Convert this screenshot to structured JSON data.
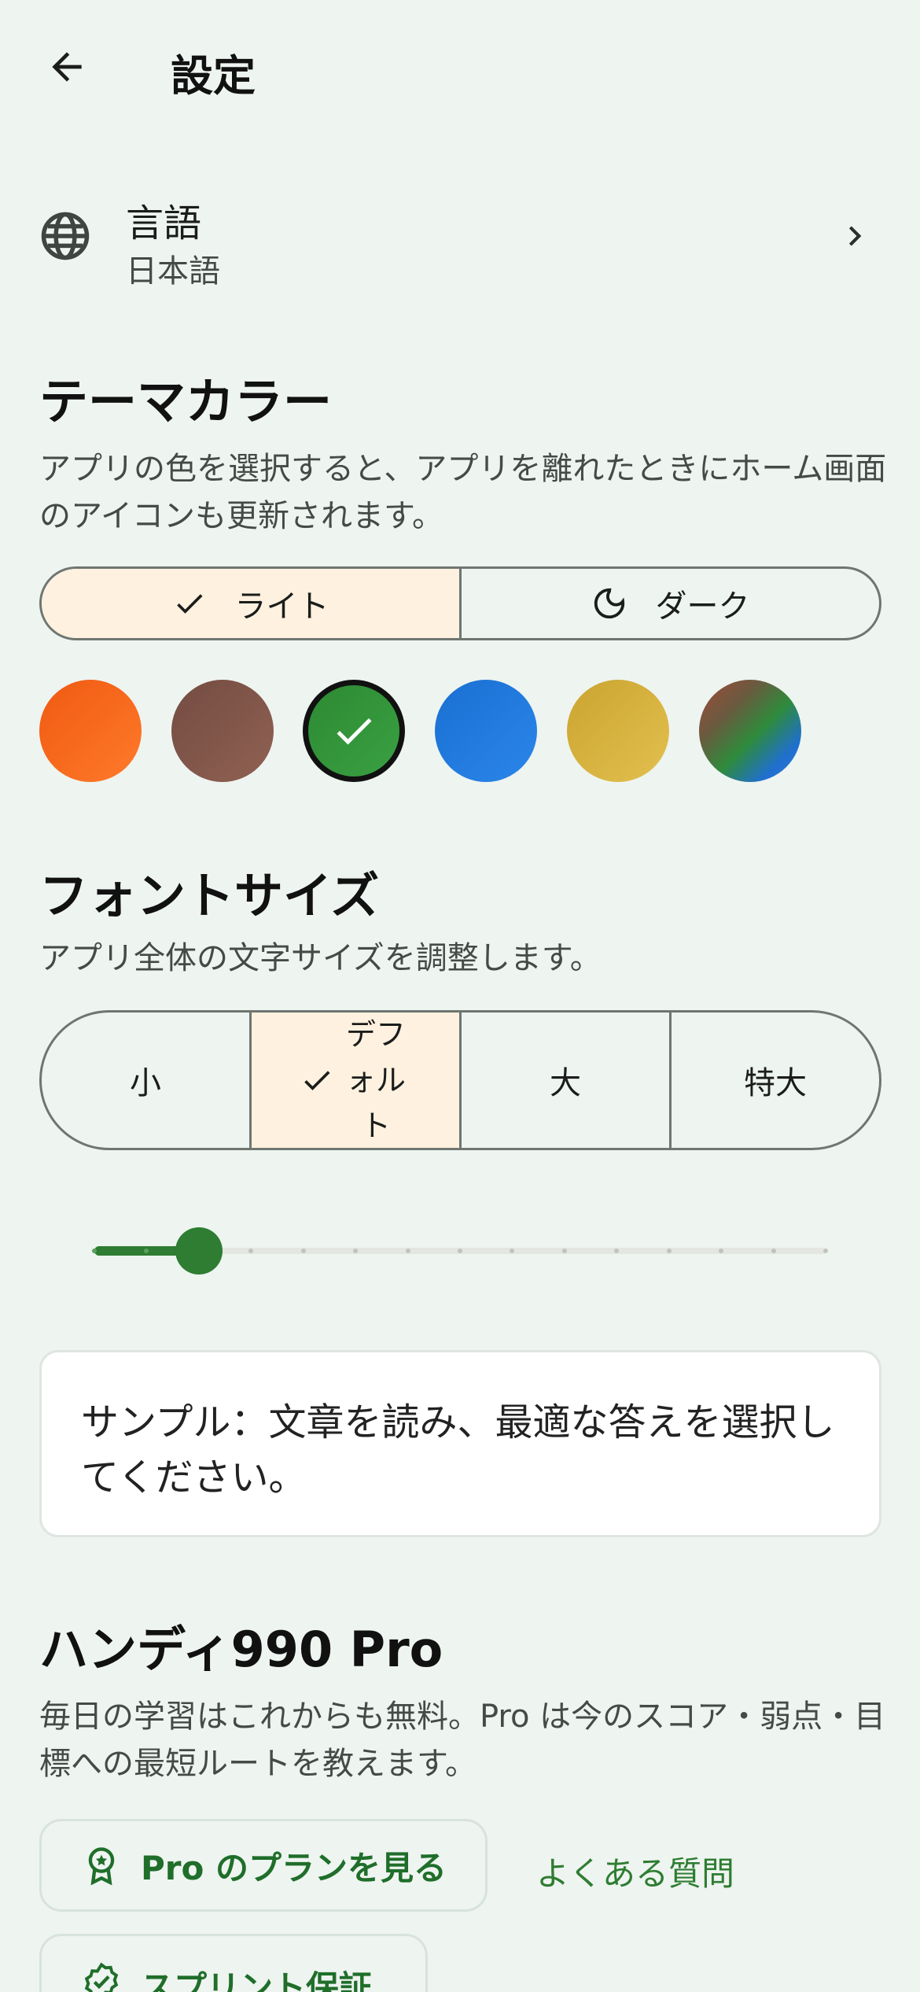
{
  "appbar": {
    "title": "設定"
  },
  "language": {
    "title": "言語",
    "value": "日本語"
  },
  "theme": {
    "heading": "テーマカラー",
    "description": "アプリの色を選択すると、アプリを離れたときにホーム画面のアイコンも更新されます。",
    "modes": [
      {
        "label": "ライト",
        "selected": true
      },
      {
        "label": "ダーク",
        "selected": false
      }
    ],
    "swatches": [
      {
        "name": "orange",
        "color": "#f4661b",
        "selected": false
      },
      {
        "name": "brown",
        "color": "#7d5548",
        "selected": false
      },
      {
        "name": "green",
        "color": "#2e8b36",
        "selected": true
      },
      {
        "name": "blue",
        "color": "#1f77d8",
        "selected": false
      },
      {
        "name": "mustard",
        "color": "#d4ad36",
        "selected": false
      },
      {
        "name": "multicolor",
        "color": "#5b6e4a",
        "selected": false
      }
    ]
  },
  "font_size": {
    "heading": "フォントサイズ",
    "description": "アプリ全体の文字サイズを調整します。",
    "options": [
      {
        "label": "小",
        "selected": false
      },
      {
        "label": "デフォルト",
        "selected": true
      },
      {
        "label": "大",
        "selected": false
      },
      {
        "label": "特大",
        "selected": false
      }
    ],
    "slider": {
      "steps": 15,
      "value_index": 2
    }
  },
  "sample": {
    "text": "サンプル：文章を読み、最適な答えを選択してください。"
  },
  "pro": {
    "heading": "ハンディ990 Pro",
    "description": "毎日の学習はこれからも無料。Pro は今のスコア・弱点・目標への最短ルートを教えます。",
    "plans_button": "Pro のプランを見る",
    "faq_link": "よくある質問",
    "sprint_button": "スプリント保証"
  },
  "colors": {
    "accent": "#2e7d32",
    "selected_bg": "#fff1df",
    "page_bg": "#eef4f0"
  }
}
